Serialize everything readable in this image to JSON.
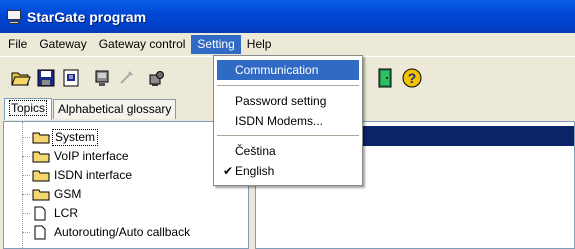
{
  "window": {
    "title": "StarGate program"
  },
  "menubar": {
    "items": [
      "File",
      "Gateway",
      "Gateway control",
      "Setting",
      "Help"
    ]
  },
  "setting_menu": {
    "items": [
      {
        "label": "Communication",
        "highlighted": true
      },
      {
        "label": "Password setting"
      },
      {
        "label": "ISDN Modems..."
      },
      {
        "label": "Čeština"
      },
      {
        "label": "English",
        "checked": true
      }
    ]
  },
  "tabs": [
    "Topics",
    "Alphabetical glossary"
  ],
  "tree": {
    "items": [
      {
        "label": "System",
        "icon": "folder-icon",
        "selected": true
      },
      {
        "label": "VoIP interface",
        "icon": "folder-icon"
      },
      {
        "label": "ISDN interface",
        "icon": "folder-icon"
      },
      {
        "label": "GSM",
        "icon": "folder-icon"
      },
      {
        "label": "LCR",
        "icon": "page-icon"
      },
      {
        "label": "Autorouting/Auto callback",
        "icon": "page-icon"
      }
    ]
  },
  "toolbar": {
    "buttons": [
      "open-folder-icon",
      "save-icon",
      "properties-icon",
      "inspect-icon",
      "disabled-tool-icon",
      "connect-icon",
      "exit-door-icon",
      "help-icon"
    ]
  },
  "colors": {
    "title_bar": "#0046d5",
    "highlight": "#316ac5",
    "selection_bar": "#0a246a"
  }
}
